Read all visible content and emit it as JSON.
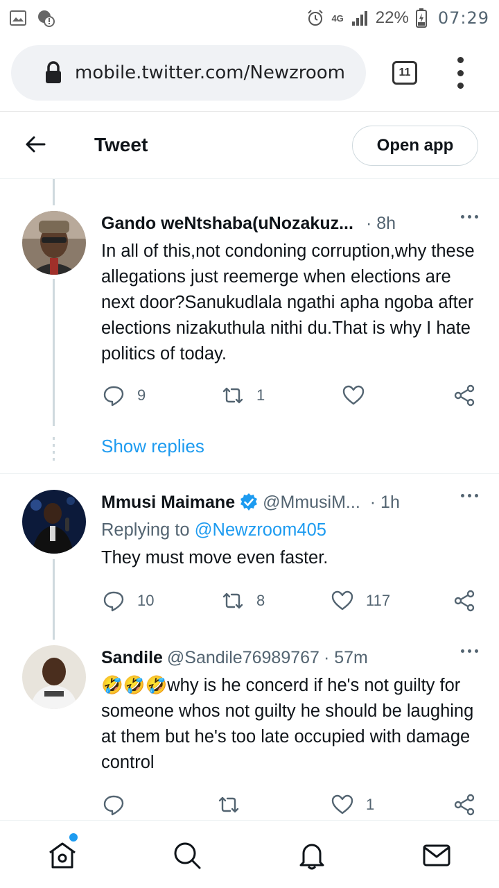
{
  "status_bar": {
    "network": "4G",
    "battery": "22%",
    "time": "07:29"
  },
  "browser": {
    "url": "mobile.twitter.com/Newzroom",
    "tab_count": "11"
  },
  "header": {
    "title": "Tweet",
    "open_app": "Open app"
  },
  "tweets": [
    {
      "name": "Gando weNtshaba(uNozakuz...",
      "handle": "",
      "time": "· 8h",
      "text": "In all of this,not condoning corruption,why these allegations just reemerge when elections are next door?Sanukudlala ngathi apha ngoba after elections nizakuthula nithi du.That is why I hate politics of today.",
      "replies": "9",
      "retweets": "1",
      "likes": "",
      "show_replies": "Show replies"
    },
    {
      "name": "Mmusi Maimane",
      "handle": "@MmusiM...",
      "time": "· 1h",
      "replying_prefix": "Replying to",
      "replying_to": "@Newzroom405",
      "text": "They must move even faster.",
      "replies": "10",
      "retweets": "8",
      "likes": "117",
      "verified": true
    },
    {
      "name": "Sandile",
      "handle": "@Sandile76989767",
      "time": "· 57m",
      "emoji": "🤣🤣🤣",
      "text": "why is he concerd if he's not guilty for someone whos not guilty he should be laughing at them but he's too late occupied with damage control",
      "replies": "",
      "retweets": "",
      "likes": "1"
    }
  ],
  "nav": {
    "items": [
      "home-icon",
      "search-icon",
      "notifications-icon",
      "messages-icon"
    ]
  },
  "colors": {
    "accent": "#1d9bf0",
    "text": "#0f1419",
    "secondary": "#536471",
    "border": "#eff3f4"
  }
}
